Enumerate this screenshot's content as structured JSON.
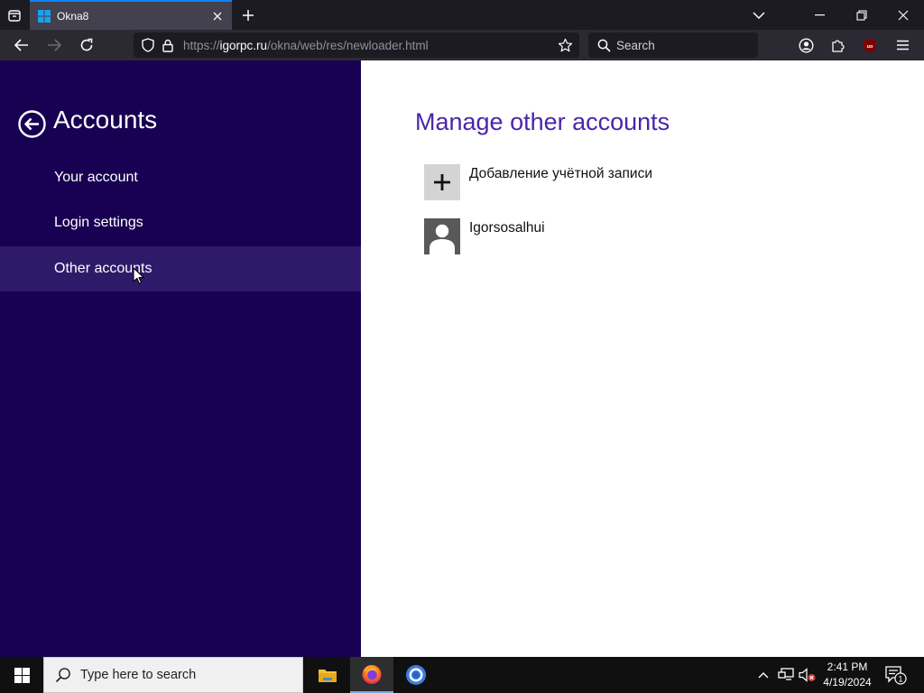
{
  "browser": {
    "tab": {
      "title": "Okna8"
    },
    "url": {
      "scheme": "https://",
      "host": "igorpc.ru",
      "path": "/okna/web/res/newloader.html"
    },
    "search": {
      "placeholder": "Search"
    },
    "extension_badge": "uo"
  },
  "sidebar": {
    "title": "Accounts",
    "items": [
      {
        "label": "Your account",
        "selected": false
      },
      {
        "label": "Login settings",
        "selected": false
      },
      {
        "label": "Other accounts",
        "selected": true
      }
    ]
  },
  "main": {
    "title": "Manage other accounts",
    "add_account_label": "Добавление учётной записи",
    "accounts": [
      {
        "name": "Igorsosalhui"
      }
    ]
  },
  "taskbar": {
    "search_placeholder": "Type here to search",
    "time": "2:41 PM",
    "date": "4/19/2024",
    "notification_count": "1"
  },
  "colors": {
    "sidebar_bg": "#180052",
    "sidebar_selected": "#2f1a69",
    "title_accent": "#4a25aa",
    "browser_accent": "#0b84ff"
  }
}
